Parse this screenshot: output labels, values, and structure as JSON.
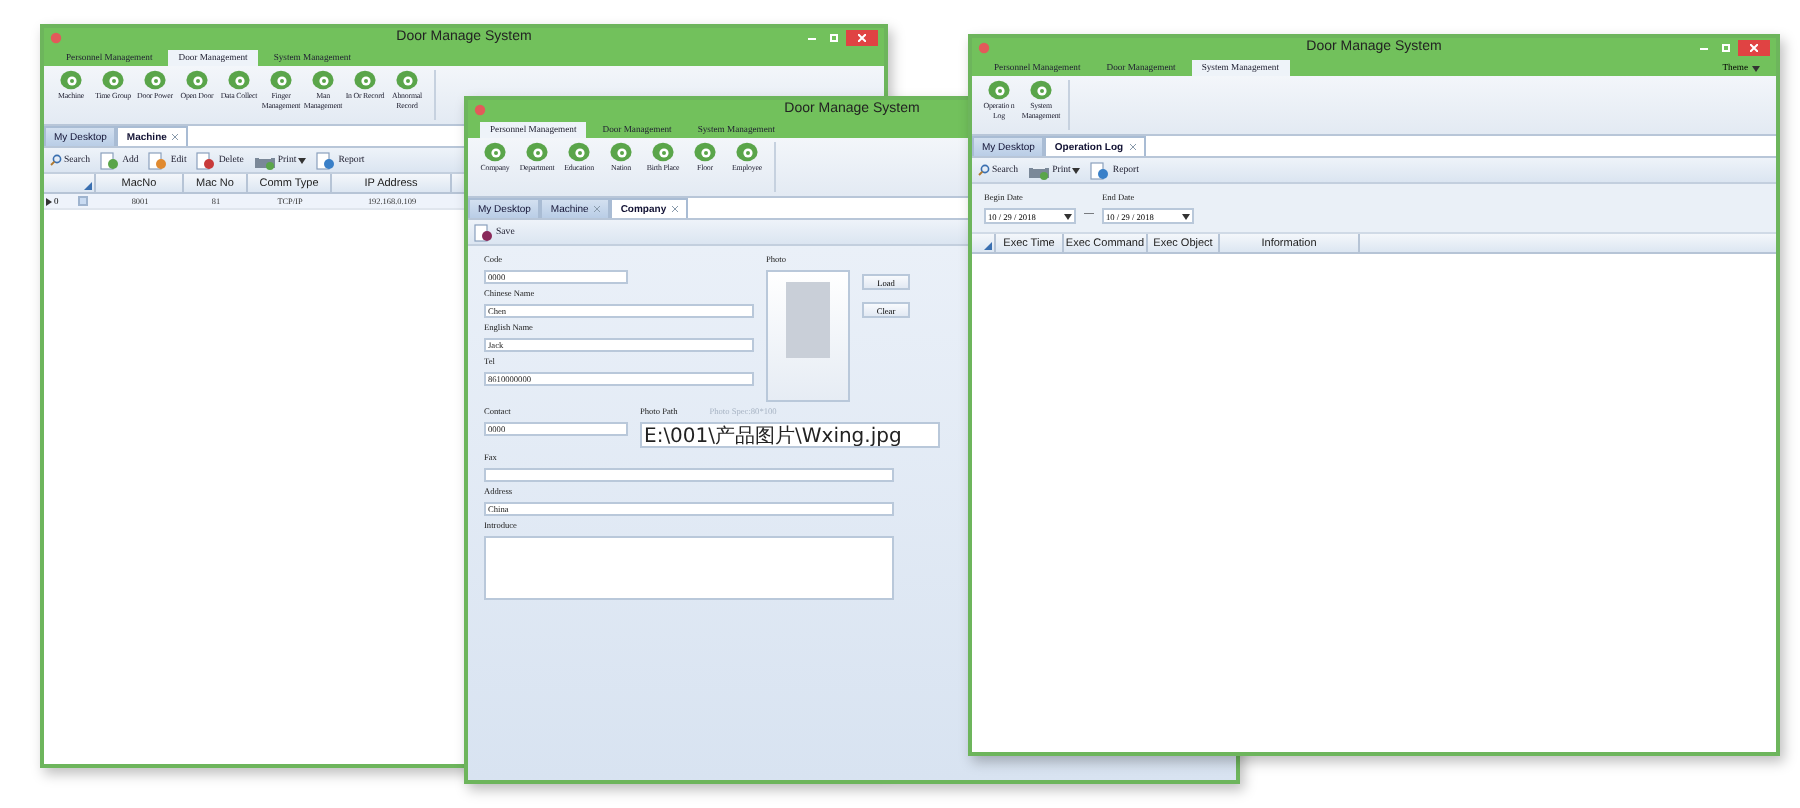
{
  "windows": [
    {
      "kind": "table",
      "title": "Door Manage System",
      "controls": true,
      "menu_tabs": [
        {
          "label": "Personnel Management",
          "selected": false
        },
        {
          "label": "Door Management",
          "selected": true
        },
        {
          "label": "System Management",
          "selected": false
        }
      ],
      "ribbon": [
        "Machine",
        "Time Group",
        "Door Power",
        "Open Door",
        "Data Collect",
        "Finger Management",
        "Man Management",
        "In Or Record",
        "Abnormal Record"
      ],
      "doc_tabs": [
        {
          "label": "My Desktop",
          "selected": false,
          "closable": false
        },
        {
          "label": "Machine",
          "selected": true,
          "closable": true
        }
      ],
      "toolbar": [
        {
          "label": "Search",
          "kind": "search"
        },
        {
          "label": "Add",
          "kind": "add"
        },
        {
          "label": "Edit",
          "kind": "edit"
        },
        {
          "label": "Delete",
          "kind": "delete"
        },
        {
          "label": "Print",
          "kind": "print"
        },
        {
          "label": "Report",
          "kind": "report"
        }
      ],
      "table": {
        "columns": [
          "MacNo",
          "Mac No",
          "Comm Type",
          "IP Address"
        ],
        "rows": [
          {
            "indicator": "0",
            "current": true,
            "checked": false,
            "cells": [
              "8001",
              "81",
              "TCP/IP",
              "192.168.0.109"
            ]
          }
        ]
      }
    },
    {
      "kind": "form",
      "title": "Door Manage System",
      "controls": false,
      "menu_tabs": [
        {
          "label": "Personnel Management",
          "selected": true
        },
        {
          "label": "Door Management",
          "selected": false
        },
        {
          "label": "System Management",
          "selected": false
        }
      ],
      "ribbon": [
        "Company",
        "Department",
        "Education",
        "Nation",
        "Birth Place",
        "Floor",
        "Employee"
      ],
      "doc_tabs": [
        {
          "label": "My Desktop",
          "selected": false,
          "closable": false
        },
        {
          "label": "Machine",
          "selected": false,
          "closable": true
        },
        {
          "label": "Company",
          "selected": true,
          "closable": true
        }
      ],
      "toolbar": [
        {
          "label": "Save",
          "kind": "save"
        }
      ],
      "form": {
        "top_fields": [
          {
            "label": "Code",
            "value": "0000",
            "kind": "short"
          },
          {
            "label": "Chinese Name",
            "value": "Chen",
            "kind": "long"
          },
          {
            "label": "English Name",
            "value": "Jack",
            "kind": "long"
          },
          {
            "label": "Tel",
            "value": "8610000000",
            "kind": "long"
          }
        ],
        "pair_fields": [
          {
            "label": "Contact",
            "value": "0000",
            "kind": "short"
          },
          {
            "label": "Photo Path",
            "value": "E:\\001\\产品图片\\Wxing.jpg",
            "kind": "path"
          }
        ],
        "bottom_fields": [
          {
            "label": "Fax",
            "kind": "wide"
          },
          {
            "label": "Address",
            "value": "China",
            "kind": "wide"
          },
          {
            "label": "Introduce",
            "kind": "area"
          }
        ],
        "photo": {
          "label": "Photo",
          "hint": "Photo Spec:80*100"
        },
        "buttons": [
          "Load",
          "Clear"
        ]
      }
    },
    {
      "kind": "log",
      "title": "Door Manage System",
      "controls": true,
      "theme": "Theme",
      "menu_tabs": [
        {
          "label": "Personnel Management",
          "selected": false
        },
        {
          "label": "Door Management",
          "selected": false
        },
        {
          "label": "System Management",
          "selected": true
        }
      ],
      "ribbon": [
        "Operatio n Log",
        "System Management"
      ],
      "doc_tabs": [
        {
          "label": "My Desktop",
          "selected": false,
          "closable": false
        },
        {
          "label": "Operation Log",
          "selected": true,
          "closable": true
        }
      ],
      "toolbar": [
        {
          "label": "Search",
          "kind": "search"
        },
        {
          "label": "Print",
          "kind": "print"
        },
        {
          "label": "Report",
          "kind": "report"
        }
      ],
      "dates": {
        "begin": {
          "label": "Begin Date",
          "value": "10 / 29 / 2018"
        },
        "separator": "—",
        "end": {
          "label": "End Date",
          "value": "10 / 29 / 2018"
        }
      },
      "table": {
        "columns": [
          "Exec Time",
          "Exec Command",
          "Exec Object",
          "Information"
        ]
      }
    }
  ]
}
